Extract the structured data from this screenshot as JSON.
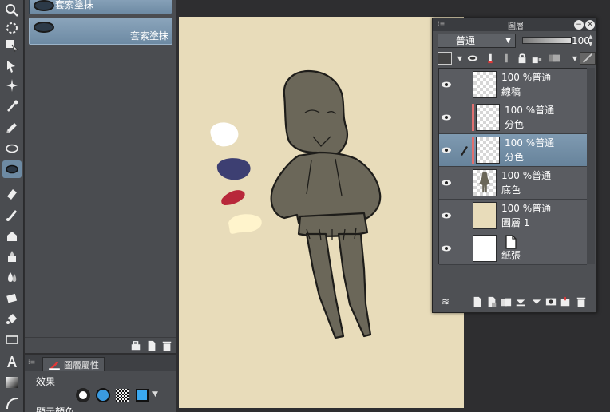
{
  "subtool": {
    "items": [
      {
        "label": "套索塗抹"
      },
      {
        "label": "套索塗抹"
      }
    ]
  },
  "property": {
    "tab_label": "圖層屬性",
    "effect_label": "效果",
    "display_color_label": "顯示顏色"
  },
  "layer_panel": {
    "title": "圖層",
    "blend_mode": "普通",
    "opacity": "100",
    "layers": [
      {
        "line1": "100 %普通",
        "line2": "線稿",
        "thumb": "checker",
        "clip": false,
        "selected": false,
        "pen": false
      },
      {
        "line1": "100 %普通",
        "line2": "分色",
        "thumb": "checker",
        "clip": true,
        "selected": false,
        "pen": false
      },
      {
        "line1": "100 %普通",
        "line2": "分色",
        "thumb": "checker",
        "clip": true,
        "selected": true,
        "pen": true
      },
      {
        "line1": "100 %普通",
        "line2": "底色",
        "thumb": "figure",
        "clip": false,
        "selected": false,
        "pen": false
      },
      {
        "line1": "100 %普通",
        "line2": "圖層 1",
        "thumb": "tan",
        "clip": false,
        "selected": false,
        "pen": false
      },
      {
        "line1": "",
        "line2": "紙張",
        "thumb": "white",
        "clip": false,
        "selected": false,
        "pen": false
      }
    ]
  },
  "canvas": {
    "paper_color": "#e8dcba",
    "figure_color": "#6b6759",
    "swatches": [
      "#ffffff",
      "#3d3f72",
      "#b8283a",
      "#fff4cc"
    ]
  },
  "colors": {
    "accent": "#6d8aa3",
    "clip_marker": "#e07070"
  }
}
